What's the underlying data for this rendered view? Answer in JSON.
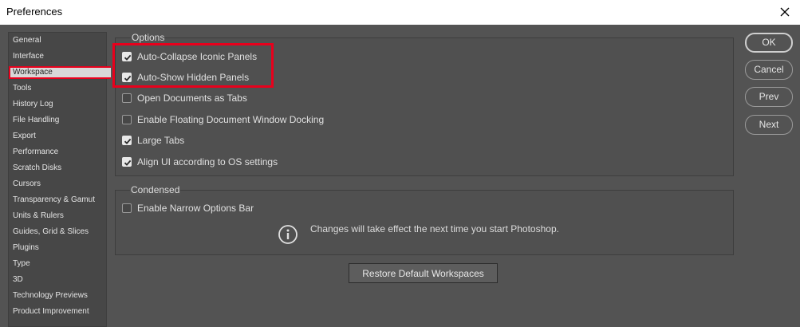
{
  "window": {
    "title": "Preferences",
    "close_icon": "close-icon"
  },
  "sidebar": {
    "selected_index": 2,
    "items": [
      {
        "label": "General"
      },
      {
        "label": "Interface"
      },
      {
        "label": "Workspace"
      },
      {
        "label": "Tools"
      },
      {
        "label": "History Log"
      },
      {
        "label": "File Handling"
      },
      {
        "label": "Export"
      },
      {
        "label": "Performance"
      },
      {
        "label": "Scratch Disks"
      },
      {
        "label": "Cursors"
      },
      {
        "label": "Transparency & Gamut"
      },
      {
        "label": "Units & Rulers"
      },
      {
        "label": "Guides, Grid & Slices"
      },
      {
        "label": "Plugins"
      },
      {
        "label": "Type"
      },
      {
        "label": "3D"
      },
      {
        "label": "Technology Previews"
      },
      {
        "label": "Product Improvement"
      }
    ]
  },
  "options": {
    "title": "Options",
    "items": [
      {
        "label": "Auto-Collapse Iconic Panels",
        "checked": true
      },
      {
        "label": "Auto-Show Hidden Panels",
        "checked": true
      },
      {
        "label": "Open Documents as Tabs",
        "checked": false
      },
      {
        "label": "Enable Floating Document Window Docking",
        "checked": false
      },
      {
        "label": "Large Tabs",
        "checked": true
      },
      {
        "label": "Align UI according to OS settings",
        "checked": true
      }
    ]
  },
  "condensed": {
    "title": "Condensed",
    "items": [
      {
        "label": "Enable Narrow Options Bar",
        "checked": false
      }
    ],
    "info_text": "Changes will take effect the next time you start Photoshop.",
    "info_icon": "info-icon"
  },
  "buttons": {
    "ok": "OK",
    "cancel": "Cancel",
    "prev": "Prev",
    "next": "Next",
    "restore": "Restore Default Workspaces"
  },
  "colors": {
    "background": "#535353",
    "highlight": "#e8001c",
    "titlebar": "#ffffff"
  }
}
